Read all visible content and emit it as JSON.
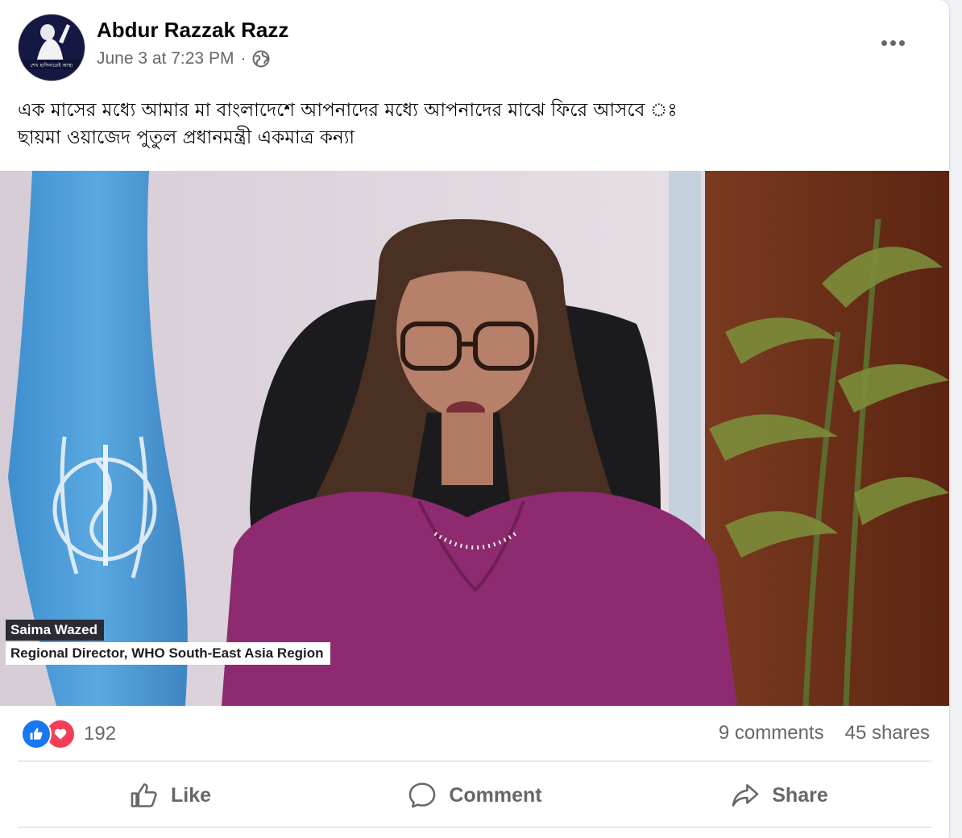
{
  "post": {
    "author": "Abdur Razzak Razz",
    "timestamp": "June 3 at 7:23 PM",
    "separator": "·",
    "audience_icon": "globe-icon",
    "avatar_caption": "শেখ হাসিনাতেই আস্থা",
    "text_line1": "এক মাসের মধ্যে আমার মা বাংলাদেশে আপনাদের মধ্যে আপনাদের মাঝে ফিরে আসবে ঃ",
    "text_line2": "ছায়মা ওয়াজেদ পুতুল প্রধানমন্ত্রী একমাত্র কন্যা"
  },
  "video": {
    "lower_third_name": "Saima Wazed",
    "lower_third_title": "Regional Director, WHO South-East Asia Region"
  },
  "engagement": {
    "reaction_icons": [
      "like-reaction-icon",
      "love-reaction-icon"
    ],
    "reaction_count": "192",
    "comments": "9 comments",
    "shares": "45 shares"
  },
  "actions": {
    "like": "Like",
    "comment": "Comment",
    "share": "Share"
  },
  "colors": {
    "like_blue": "#1877f2",
    "love_red": "#f33e58",
    "secondary_text": "#65676b",
    "blouse_magenta": "#8e2a6f"
  }
}
